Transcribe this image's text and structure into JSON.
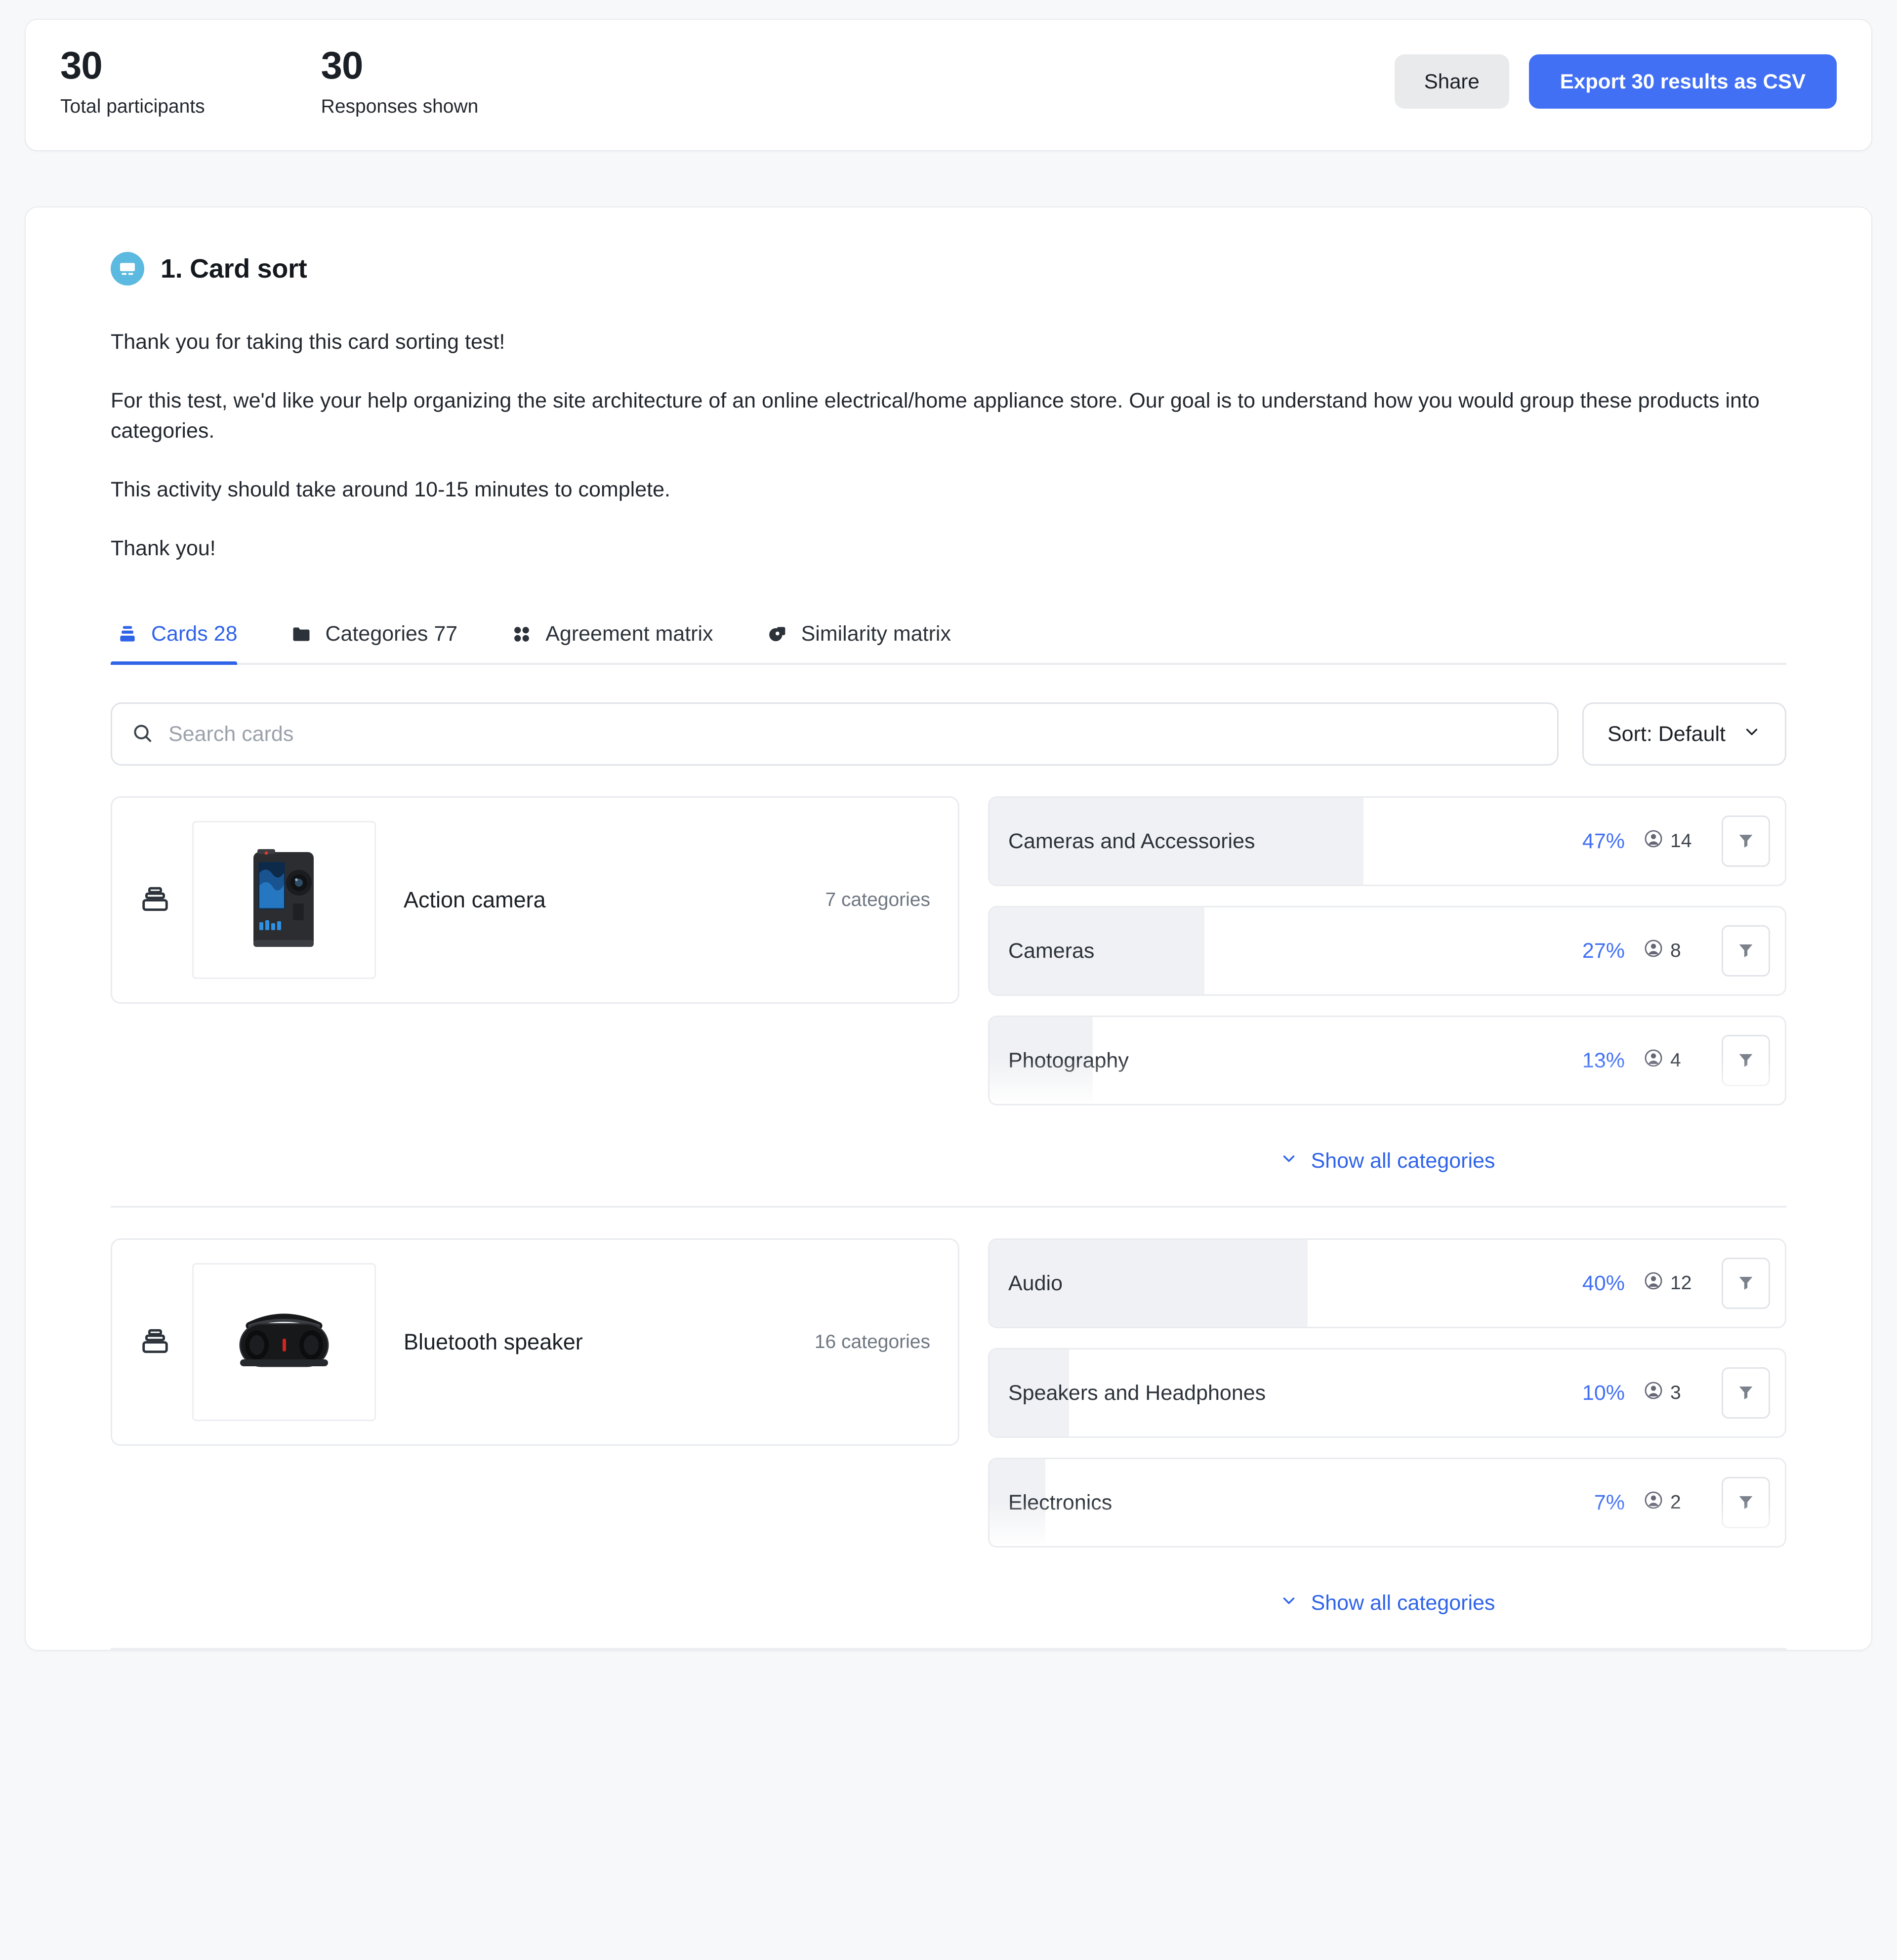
{
  "summary": {
    "stats": [
      {
        "value": "30",
        "label": "Total participants"
      },
      {
        "value": "30",
        "label": "Responses shown"
      }
    ],
    "share_label": "Share",
    "export_label": "Export 30 results as CSV"
  },
  "question": {
    "icon": "card-sort-icon",
    "title": "1. Card sort",
    "description": [
      "Thank you for taking this card sorting test!",
      "For this test, we'd like your help organizing the site architecture of an online electrical/home appliance store. Our goal is to understand how you would group these products into categories.",
      "This activity should take around 10-15 minutes to complete.",
      "Thank you!"
    ]
  },
  "tabs": [
    {
      "label": "Cards 28",
      "icon": "cards-icon",
      "active": true
    },
    {
      "label": "Categories 77",
      "icon": "folder-icon",
      "active": false
    },
    {
      "label": "Agreement matrix",
      "icon": "grid-icon",
      "active": false
    },
    {
      "label": "Similarity matrix",
      "icon": "shapes-icon",
      "active": false
    }
  ],
  "toolbar": {
    "search_placeholder": "Search cards",
    "search_value": "",
    "sort_label": "Sort: Default"
  },
  "show_all_label": "Show all categories",
  "cards": [
    {
      "name": "Action camera",
      "thumb": "action-camera-thumb",
      "count_label": "7 categories",
      "categories": [
        {
          "label": "Cameras and Accessories",
          "pct": "47%",
          "pct_value": 47,
          "people": "14"
        },
        {
          "label": "Cameras",
          "pct": "27%",
          "pct_value": 27,
          "people": "8"
        },
        {
          "label": "Photography",
          "pct": "13%",
          "pct_value": 13,
          "people": "4"
        }
      ]
    },
    {
      "name": "Bluetooth speaker",
      "thumb": "bluetooth-speaker-thumb",
      "count_label": "16 categories",
      "categories": [
        {
          "label": "Audio",
          "pct": "40%",
          "pct_value": 40,
          "people": "12"
        },
        {
          "label": "Speakers and Headphones",
          "pct": "10%",
          "pct_value": 10,
          "people": "3"
        },
        {
          "label": "Electronics",
          "pct": "7%",
          "pct_value": 7,
          "people": "2"
        }
      ]
    }
  ],
  "colors": {
    "accent_blue": "#4170f4",
    "link_blue": "#2f63e8",
    "icon_badge": "#5cb9e0",
    "bar_fill": "#f0f1f4",
    "page_bg": "#f7f8fa"
  }
}
